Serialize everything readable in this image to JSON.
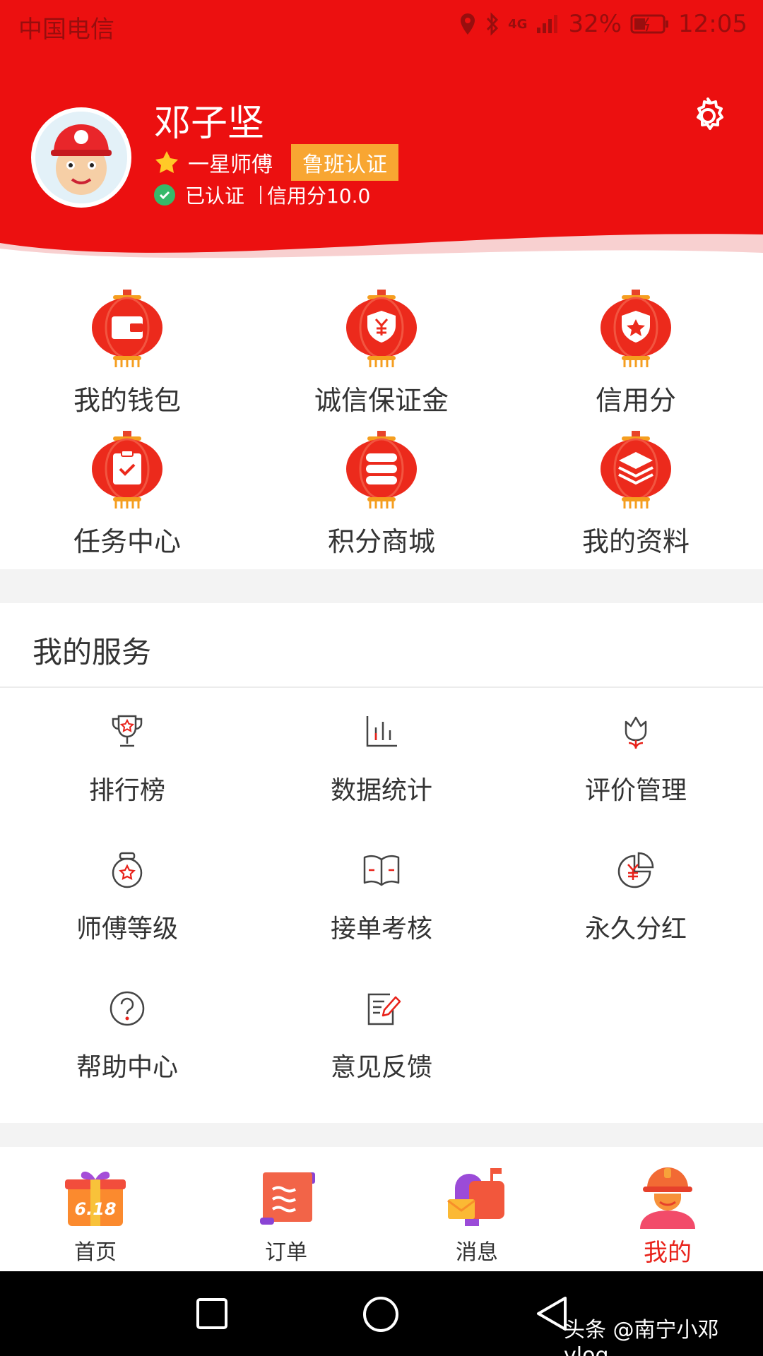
{
  "status_bar": {
    "carrier": "中国电信",
    "network": "4G",
    "battery": "32%",
    "time": "12:05"
  },
  "profile": {
    "name": "邓子坚",
    "level": "一星师傅",
    "badge": "鲁班认证",
    "verified": "已认证",
    "credit": "信用分10.0"
  },
  "quick_grid": [
    {
      "label": "我的钱包",
      "icon": "wallet-icon"
    },
    {
      "label": "诚信保证金",
      "icon": "shield-yuan-icon"
    },
    {
      "label": "信用分",
      "icon": "shield-star-icon"
    },
    {
      "label": "任务中心",
      "icon": "clipboard-check-icon"
    },
    {
      "label": "积分商城",
      "icon": "coin-stack-icon"
    },
    {
      "label": "我的资料",
      "icon": "layers-icon"
    }
  ],
  "services": {
    "title": "我的服务",
    "items": [
      {
        "label": "排行榜",
        "icon": "trophy-icon"
      },
      {
        "label": "数据统计",
        "icon": "bar-chart-icon"
      },
      {
        "label": "评价管理",
        "icon": "flower-icon"
      },
      {
        "label": "师傅等级",
        "icon": "medal-icon"
      },
      {
        "label": "接单考核",
        "icon": "book-icon"
      },
      {
        "label": "永久分红",
        "icon": "yuan-pie-icon"
      },
      {
        "label": "帮助中心",
        "icon": "help-icon"
      },
      {
        "label": "意见反馈",
        "icon": "feedback-icon"
      }
    ]
  },
  "tabs": [
    {
      "label": "首页",
      "icon": "gift-618-icon",
      "badge_text": "6.18"
    },
    {
      "label": "订单",
      "icon": "scroll-icon"
    },
    {
      "label": "消息",
      "icon": "mailbox-icon"
    },
    {
      "label": "我的",
      "icon": "worker-helmet-icon",
      "active": true
    }
  ],
  "watermark": "头条 @南宁小邓vlog",
  "colors": {
    "brand_red": "#ec1010",
    "badge_orange": "#f8a632",
    "verified_green": "#37b96a",
    "active_tab": "#e8221a"
  }
}
